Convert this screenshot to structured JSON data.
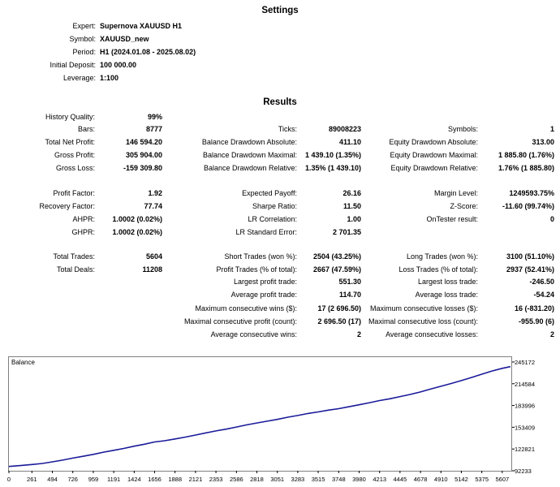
{
  "settings": {
    "title": "Settings",
    "rows": [
      {
        "label": "Expert:",
        "value": "Supernova XAUUSD H1"
      },
      {
        "label": "Symbol:",
        "value": "XAUUSD_new"
      },
      {
        "label": "Period:",
        "value": "H1 (2024.01.08 - 2025.08.02)"
      },
      {
        "label": "Initial Deposit:",
        "value": "100 000.00"
      },
      {
        "label": "Leverage:",
        "value": "1:100"
      }
    ]
  },
  "results": {
    "title": "Results",
    "history_quality": {
      "label": "History Quality:",
      "value": "99%"
    },
    "col1": [
      {
        "label": "Bars:",
        "value": "8777"
      },
      {
        "label": "Total Net Profit:",
        "value": "146 594.20"
      },
      {
        "label": "Gross Profit:",
        "value": "305 904.00"
      },
      {
        "label": "Gross Loss:",
        "value": "-159 309.80"
      },
      {
        "label": "",
        "value": ""
      },
      {
        "label": "Profit Factor:",
        "value": "1.92"
      },
      {
        "label": "Recovery Factor:",
        "value": "77.74"
      },
      {
        "label": "AHPR:",
        "value": "1.0002 (0.02%)"
      },
      {
        "label": "GHPR:",
        "value": "1.0002 (0.02%)"
      },
      {
        "label": "",
        "value": ""
      },
      {
        "label": "Total Trades:",
        "value": "5604"
      },
      {
        "label": "Total Deals:",
        "value": "11208"
      }
    ],
    "col2": [
      {
        "label": "Ticks:",
        "value": "89008223"
      },
      {
        "label": "Balance Drawdown Absolute:",
        "value": "411.10"
      },
      {
        "label": "Balance Drawdown Maximal:",
        "value": "1 439.10 (1.35%)"
      },
      {
        "label": "Balance Drawdown Relative:",
        "value": "1.35% (1 439.10)"
      },
      {
        "label": "",
        "value": ""
      },
      {
        "label": "Expected Payoff:",
        "value": "26.16"
      },
      {
        "label": "Sharpe Ratio:",
        "value": "11.50"
      },
      {
        "label": "LR Correlation:",
        "value": "1.00"
      },
      {
        "label": "LR Standard Error:",
        "value": "2 701.35"
      },
      {
        "label": "",
        "value": ""
      },
      {
        "label": "Short Trades (won %):",
        "value": "2504 (43.25%)"
      },
      {
        "label": "Profit Trades (% of total):",
        "value": "2667 (47.59%)"
      },
      {
        "label": "Largest profit trade:",
        "value": "551.30"
      },
      {
        "label": "Average profit trade:",
        "value": "114.70"
      },
      {
        "label": "Maximum consecutive wins ($):",
        "value": "17 (2 696.50)"
      },
      {
        "label": "Maximal consecutive profit (count):",
        "value": "2 696.50 (17)"
      },
      {
        "label": "Average consecutive wins:",
        "value": "2"
      }
    ],
    "col3": [
      {
        "label": "Symbols:",
        "value": "1"
      },
      {
        "label": "Equity Drawdown Absolute:",
        "value": "313.00"
      },
      {
        "label": "Equity Drawdown Maximal:",
        "value": "1 885.80 (1.76%)"
      },
      {
        "label": "Equity Drawdown Relative:",
        "value": "1.76% (1 885.80)"
      },
      {
        "label": "",
        "value": ""
      },
      {
        "label": "Margin Level:",
        "value": "1249593.75%"
      },
      {
        "label": "Z-Score:",
        "value": "-11.60 (99.74%)"
      },
      {
        "label": "OnTester result:",
        "value": "0"
      },
      {
        "label": "",
        "value": ""
      },
      {
        "label": "",
        "value": ""
      },
      {
        "label": "Long Trades (won %):",
        "value": "3100 (51.10%)"
      },
      {
        "label": "Loss Trades (% of total):",
        "value": "2937 (52.41%)"
      },
      {
        "label": "Largest loss trade:",
        "value": "-246.50"
      },
      {
        "label": "Average loss trade:",
        "value": "-54.24"
      },
      {
        "label": "Maximum consecutive losses ($):",
        "value": "16 (-831.20)"
      },
      {
        "label": "Maximal consecutive loss (count):",
        "value": "-955.90 (6)"
      },
      {
        "label": "Average consecutive losses:",
        "value": "2"
      }
    ]
  },
  "chart_data": {
    "type": "line",
    "title": "Balance",
    "line_color": "#1a1a9a",
    "x_ticks": [
      0,
      261,
      494,
      726,
      959,
      1191,
      1424,
      1656,
      1888,
      2121,
      2353,
      2586,
      2818,
      3051,
      3283,
      3515,
      3748,
      3980,
      4213,
      4445,
      4678,
      4910,
      5142,
      5375,
      5607
    ],
    "y_ticks": [
      92233,
      122821,
      153409,
      183996,
      214584,
      245172
    ],
    "xlim": [
      0,
      5710
    ],
    "ylim": [
      92233,
      252000
    ],
    "series": [
      {
        "x": [
          0,
          130,
          261,
          380,
          494,
          610,
          726,
          840,
          959,
          1075,
          1191,
          1300,
          1424,
          1540,
          1656,
          1770,
          1888,
          2000,
          2121,
          2240,
          2353,
          2470,
          2586,
          2700,
          2818,
          2930,
          3051,
          3170,
          3283,
          3400,
          3515,
          3630,
          3748,
          3860,
          3980,
          4100,
          4213,
          4330,
          4445,
          4560,
          4678,
          4790,
          4910,
          5030,
          5142,
          5260,
          5375,
          5490,
          5607,
          5700
        ],
        "y": [
          98300,
          99500,
          101000,
          102500,
          104800,
          107200,
          110000,
          112500,
          115300,
          118400,
          121000,
          123500,
          126800,
          129500,
          132800,
          134500,
          137000,
          139500,
          142500,
          145500,
          148300,
          150800,
          153800,
          156700,
          159500,
          161800,
          164500,
          167500,
          170000,
          172800,
          175000,
          177500,
          179500,
          182200,
          185000,
          188000,
          191000,
          193500,
          196500,
          199500,
          203000,
          207000,
          211000,
          215000,
          219000,
          223500,
          228000,
          232500,
          236300,
          238600
        ]
      }
    ]
  }
}
